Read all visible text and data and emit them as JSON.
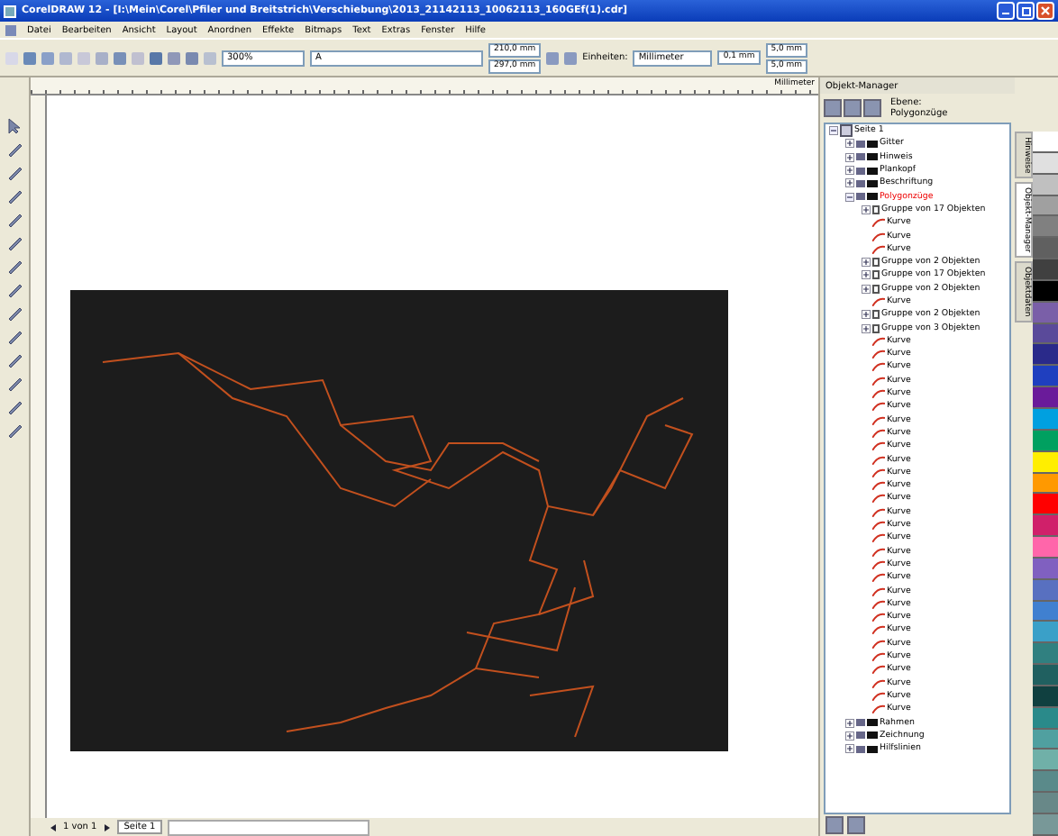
{
  "window": {
    "title": "CorelDRAW 12 - [I:\\Mein\\Corel\\Pfiler und Breitstrich\\Verschiebung\\2013_21142113_10062113_160GEf(1).cdr]"
  },
  "menu": [
    "Datei",
    "Bearbeiten",
    "Ansicht",
    "Layout",
    "Anordnen",
    "Effekte",
    "Bitmaps",
    "Text",
    "Extras",
    "Fenster",
    "Hilfe"
  ],
  "toolbar": {
    "zoom": "300%",
    "font_field": "A",
    "page_width": "210,0 mm",
    "page_height": "297,0 mm",
    "units_label": "Einheiten:",
    "units": "Millimeter",
    "nudge": "0,1 mm",
    "dup_x": "5,0 mm",
    "dup_y": "5,0 mm"
  },
  "ruler_unit": "Millimeter",
  "docker": {
    "title": "Objekt-Manager",
    "layer_label": "Ebene:",
    "layer_name": "Polygonzüge",
    "tree": [
      {
        "label": "Seite 1",
        "expanded": true,
        "children": [
          {
            "label": "Gitter",
            "kind": "layer",
            "expanded": false,
            "selected": false
          },
          {
            "label": "Hinweis",
            "kind": "layer",
            "expanded": false,
            "selected": false
          },
          {
            "label": "Plankopf",
            "kind": "layer",
            "expanded": false,
            "selected": false
          },
          {
            "label": "Beschriftung",
            "kind": "layer",
            "expanded": false,
            "selected": false
          },
          {
            "label": "Polygonzüge",
            "kind": "layer",
            "expanded": true,
            "selected": true,
            "children": [
              {
                "label": "Gruppe von 17 Objekten",
                "kind": "group",
                "expanded": false
              },
              {
                "label": "Kurve",
                "kind": "curve"
              },
              {
                "label": "Kurve",
                "kind": "curve"
              },
              {
                "label": "Kurve",
                "kind": "curve"
              },
              {
                "label": "Gruppe von 2 Objekten",
                "kind": "group",
                "expanded": false
              },
              {
                "label": "Gruppe von 17 Objekten",
                "kind": "group",
                "expanded": false
              },
              {
                "label": "Gruppe von 2 Objekten",
                "kind": "group",
                "expanded": false
              },
              {
                "label": "Kurve",
                "kind": "curve"
              },
              {
                "label": "Gruppe von 2 Objekten",
                "kind": "group",
                "expanded": false
              },
              {
                "label": "Gruppe von 3 Objekten",
                "kind": "group",
                "expanded": false
              },
              {
                "label": "Kurve",
                "kind": "curve"
              },
              {
                "label": "Kurve",
                "kind": "curve"
              },
              {
                "label": "Kurve",
                "kind": "curve"
              },
              {
                "label": "Kurve",
                "kind": "curve"
              },
              {
                "label": "Kurve",
                "kind": "curve"
              },
              {
                "label": "Kurve",
                "kind": "curve"
              },
              {
                "label": "Kurve",
                "kind": "curve"
              },
              {
                "label": "Kurve",
                "kind": "curve"
              },
              {
                "label": "Kurve",
                "kind": "curve"
              },
              {
                "label": "Kurve",
                "kind": "curve"
              },
              {
                "label": "Kurve",
                "kind": "curve"
              },
              {
                "label": "Kurve",
                "kind": "curve"
              },
              {
                "label": "Kurve",
                "kind": "curve"
              },
              {
                "label": "Kurve",
                "kind": "curve"
              },
              {
                "label": "Kurve",
                "kind": "curve"
              },
              {
                "label": "Kurve",
                "kind": "curve"
              },
              {
                "label": "Kurve",
                "kind": "curve"
              },
              {
                "label": "Kurve",
                "kind": "curve"
              },
              {
                "label": "Kurve",
                "kind": "curve"
              },
              {
                "label": "Kurve",
                "kind": "curve"
              },
              {
                "label": "Kurve",
                "kind": "curve"
              },
              {
                "label": "Kurve",
                "kind": "curve"
              },
              {
                "label": "Kurve",
                "kind": "curve"
              },
              {
                "label": "Kurve",
                "kind": "curve"
              },
              {
                "label": "Kurve",
                "kind": "curve"
              },
              {
                "label": "Kurve",
                "kind": "curve"
              },
              {
                "label": "Kurve",
                "kind": "curve"
              },
              {
                "label": "Kurve",
                "kind": "curve"
              },
              {
                "label": "Kurve",
                "kind": "curve"
              }
            ]
          },
          {
            "label": "Rahmen",
            "kind": "layer",
            "expanded": false,
            "selected": false
          },
          {
            "label": "Zeichnung",
            "kind": "layer",
            "expanded": false,
            "selected": false
          },
          {
            "label": "Hilfslinien",
            "kind": "layer",
            "expanded": false,
            "selected": false
          }
        ]
      }
    ]
  },
  "docker_tabs": [
    {
      "label": "Hinweise",
      "selected": false
    },
    {
      "label": "Objekt-Manager",
      "selected": true
    },
    {
      "label": "Objektdaten",
      "selected": false
    }
  ],
  "palette": [
    {
      "color": "#ffffff"
    },
    {
      "color": "#e0e0e0"
    },
    {
      "color": "#c0c0c0"
    },
    {
      "color": "#a0a0a0"
    },
    {
      "color": "#808080"
    },
    {
      "color": "#606060"
    },
    {
      "color": "#404040"
    },
    {
      "color": "#000000"
    },
    {
      "color": "#7a5fa8"
    },
    {
      "color": "#5a4a9a"
    },
    {
      "color": "#2a2a8a"
    },
    {
      "color": "#1f3fbf"
    },
    {
      "color": "#6a1b9a"
    },
    {
      "color": "#00a0e0"
    },
    {
      "color": "#00a060"
    },
    {
      "color": "#ffee00"
    },
    {
      "color": "#ff9900"
    },
    {
      "color": "#ff0000"
    },
    {
      "color": "#d0206a"
    },
    {
      "color": "#ff66aa"
    },
    {
      "color": "#8060c0"
    },
    {
      "color": "#5870c0"
    },
    {
      "color": "#4080d0"
    },
    {
      "color": "#3aa0c8"
    },
    {
      "color": "#308080"
    },
    {
      "color": "#206060"
    },
    {
      "color": "#104040"
    },
    {
      "color": "#2a8a8a"
    },
    {
      "color": "#50a0a0"
    },
    {
      "color": "#70b0a8"
    },
    {
      "color": "#5a8a8a"
    },
    {
      "color": "#688888"
    },
    {
      "color": "#789898"
    }
  ],
  "page_tabs": {
    "position": "1 von 1",
    "pages": [
      {
        "label": "Seite 1",
        "selected": true
      }
    ]
  }
}
